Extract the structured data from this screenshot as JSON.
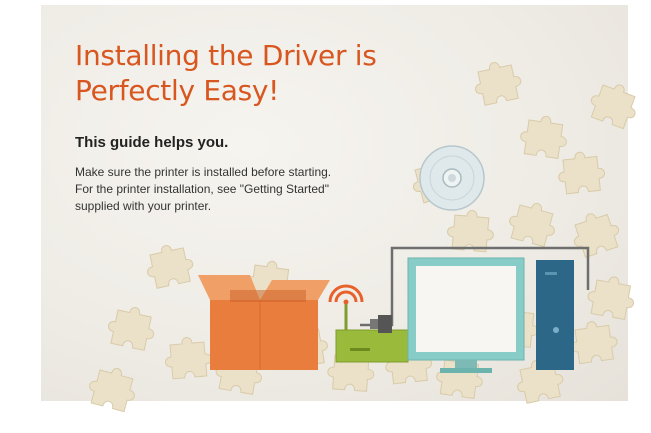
{
  "headline": {
    "line1": "Installing the Driver is",
    "line2": "Perfectly Easy!"
  },
  "subhead": "This guide helps you.",
  "body": [
    "Make sure the printer is installed before starting.",
    "For the printer installation, see \"Getting Started\"",
    "supplied with your printer."
  ],
  "colors": {
    "headline": "#d8561f",
    "background": "#efece6",
    "puzzle": "#ebe1c9",
    "box": "#e87d3e",
    "router": "#9aba3c",
    "wifi": "#e9612a",
    "monitor": "#88ccc8",
    "tower": "#2c6788"
  },
  "icons": [
    "puzzle-pieces",
    "cd-disc-icon",
    "cardboard-box-icon",
    "wifi-router-icon",
    "computer-monitor-icon",
    "pc-tower-icon",
    "usb-cable-icon"
  ]
}
